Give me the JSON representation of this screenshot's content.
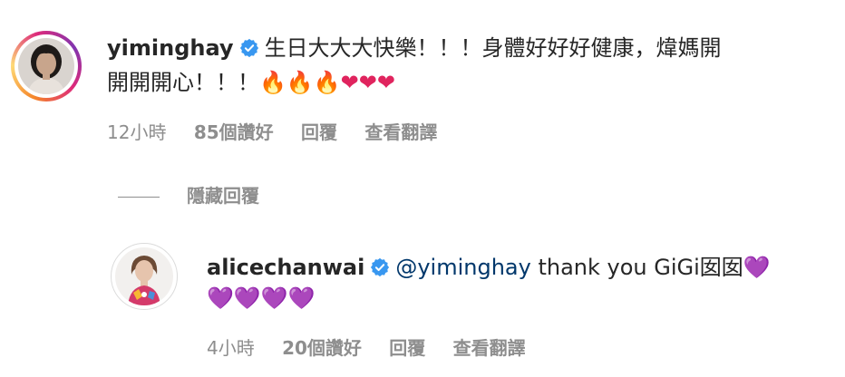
{
  "comment1": {
    "username": "yiminghay",
    "text_line1": "生日大大大快樂！！！身體好好好健康，煒媽開",
    "text_line2": "開開開心！！！",
    "emojis": "🔥🔥🔥❤❤❤",
    "time": "12小時",
    "likes": "85個讚好",
    "reply": "回覆",
    "translate": "查看翻譯"
  },
  "hide_replies": "隱藏回覆",
  "comment2": {
    "username": "alicechanwai",
    "mention": "@yiminghay",
    "text": " thank you GiGi囡囡",
    "heart_inline": "💜",
    "hearts_line2": "💜💜💜💜",
    "time": "4小時",
    "likes": "20個讚好",
    "reply": "回覆",
    "translate": "查看翻譯"
  },
  "colors": {
    "verified_blue": "#3897f0",
    "meta_gray": "#8e8e8e",
    "mention_blue": "#00376b"
  }
}
